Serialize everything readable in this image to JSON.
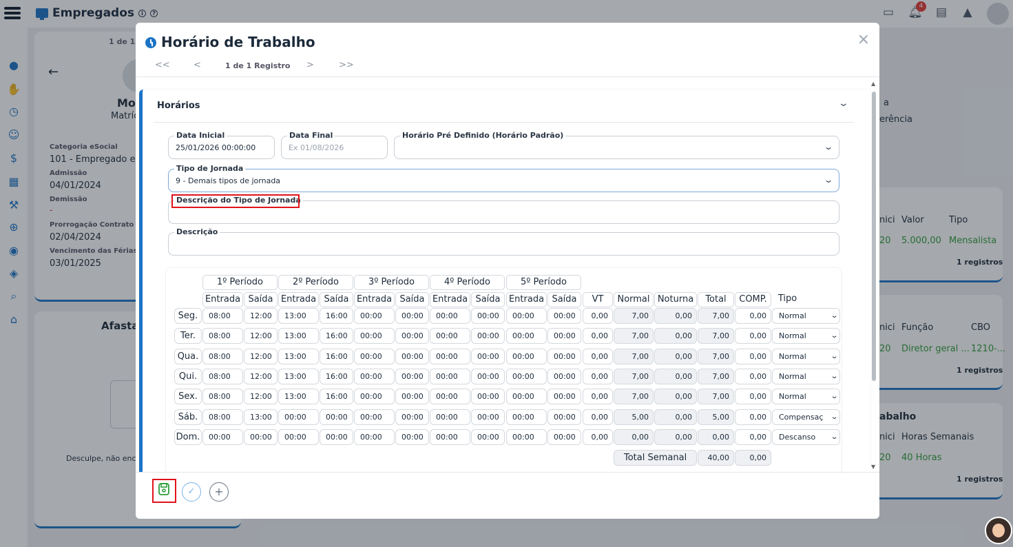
{
  "app": {
    "title": "Empregados",
    "notif_count": "4"
  },
  "background": {
    "pager_text": "1 de 1 R",
    "employee_name": "Mo",
    "employee_sub": "Matríc",
    "categoria_label": "Categoria eSocial",
    "categoria_value": "101 - Empregado e T",
    "admissao_label": "Admissão",
    "admissao_value": "04/01/2024",
    "demissao_label": "Demissão",
    "demissao_value": "-",
    "prorrogacao_label": "Prorrogação Contrato de",
    "prorrogacao_value": "02/04/2024",
    "vencimento_label": "Vencimento das Férias",
    "vencimento_value": "03/01/2025",
    "afastamentos_title": "Afasta",
    "empty_msg": "Desculpe, não enco",
    "right_frag1": "a",
    "right_frag2": "erência",
    "card1": {
      "col_start": "nici",
      "col2": "Valor",
      "col3": "Tipo",
      "v_start": "20",
      "v2": "5.000,00",
      "v3": "Mensalista",
      "count": "1 registros"
    },
    "card2": {
      "col_start": "nici",
      "col2": "Função",
      "col3": "CBO",
      "v_start": "20",
      "v2": "Diretor geral ...",
      "v3": "1210-...",
      "count": "1 registros"
    },
    "card3": {
      "title": "abalho",
      "col_start": "nici",
      "col2": "Horas Semanais",
      "v_start": "20",
      "v2": "40 Horas",
      "count": "1 registros"
    }
  },
  "modal": {
    "title": "Horário de Trabalho",
    "pager": {
      "first": "<<",
      "prev": "<",
      "text": "1 de 1 Registro",
      "next": ">",
      "last": ">>"
    },
    "close": "×",
    "section_title": "Horários",
    "fields": {
      "data_inicial": {
        "label": "Data Inicial",
        "value": "25/01/2026 00:00:00"
      },
      "data_final": {
        "label": "Data Final",
        "placeholder": "Ex 01/08/2026"
      },
      "horario_padrao": {
        "label": "Horário Pré Definido (Horário Padrão)",
        "value": ""
      },
      "tipo_jornada": {
        "label": "Tipo de Jornada",
        "value": "9 - Demais tipos de jornada"
      },
      "desc_tipo_jornada": {
        "label": "Descrição do Tipo de Jornada",
        "value": ""
      },
      "descricao": {
        "label": "Descrição",
        "value": ""
      }
    },
    "schedule": {
      "periods": [
        "1º Período",
        "2º Período",
        "3º Período",
        "4º Período",
        "5º Período"
      ],
      "columns": [
        "Entrada",
        "Saída",
        "Entrada",
        "Saída",
        "Entrada",
        "Saída",
        "Entrada",
        "Saída",
        "Entrada",
        "Saída",
        "VT",
        "Normal",
        "Noturna",
        "Total",
        "COMP.",
        "Tipo"
      ],
      "rows": [
        {
          "day": "Seg.",
          "times": [
            "08:00",
            "12:00",
            "13:00",
            "16:00",
            "00:00",
            "00:00",
            "00:00",
            "00:00",
            "00:00",
            "00:00"
          ],
          "vt": "0,00",
          "normal": "7,00",
          "noturna": "0,00",
          "total": "7,00",
          "comp": "0,00",
          "tipo": "Normal"
        },
        {
          "day": "Ter.",
          "times": [
            "08:00",
            "12:00",
            "13:00",
            "16:00",
            "00:00",
            "00:00",
            "00:00",
            "00:00",
            "00:00",
            "00:00"
          ],
          "vt": "0,00",
          "normal": "7,00",
          "noturna": "0,00",
          "total": "7,00",
          "comp": "0,00",
          "tipo": "Normal"
        },
        {
          "day": "Qua.",
          "times": [
            "08:00",
            "12:00",
            "13:00",
            "16:00",
            "00:00",
            "00:00",
            "00:00",
            "00:00",
            "00:00",
            "00:00"
          ],
          "vt": "0,00",
          "normal": "7,00",
          "noturna": "0,00",
          "total": "7,00",
          "comp": "0,00",
          "tipo": "Normal"
        },
        {
          "day": "Qui.",
          "times": [
            "08:00",
            "12:00",
            "13:00",
            "16:00",
            "00:00",
            "00:00",
            "00:00",
            "00:00",
            "00:00",
            "00:00"
          ],
          "vt": "0,00",
          "normal": "7,00",
          "noturna": "0,00",
          "total": "7,00",
          "comp": "0,00",
          "tipo": "Normal"
        },
        {
          "day": "Sex.",
          "times": [
            "08:00",
            "12:00",
            "13:00",
            "16:00",
            "00:00",
            "00:00",
            "00:00",
            "00:00",
            "00:00",
            "00:00"
          ],
          "vt": "0,00",
          "normal": "7,00",
          "noturna": "0,00",
          "total": "7,00",
          "comp": "0,00",
          "tipo": "Normal"
        },
        {
          "day": "Sáb.",
          "times": [
            "08:00",
            "13:00",
            "00:00",
            "00:00",
            "00:00",
            "00:00",
            "00:00",
            "00:00",
            "00:00",
            "00:00"
          ],
          "vt": "0,00",
          "normal": "5,00",
          "noturna": "0,00",
          "total": "5,00",
          "comp": "0,00",
          "tipo": "Compensaç"
        },
        {
          "day": "Dom.",
          "times": [
            "00:00",
            "00:00",
            "00:00",
            "00:00",
            "00:00",
            "00:00",
            "00:00",
            "00:00",
            "00:00",
            "00:00"
          ],
          "vt": "0,00",
          "normal": "0,00",
          "noturna": "0,00",
          "total": "0,00",
          "comp": "0,00",
          "tipo": "Descanso"
        }
      ],
      "total_label": "Total Semanal",
      "total_value": "40,00",
      "total_comp": "0,00"
    },
    "colors": {
      "accent": "#1b73c6",
      "save_green": "#2e9d3b",
      "highlight_red": "#e0121b"
    }
  }
}
